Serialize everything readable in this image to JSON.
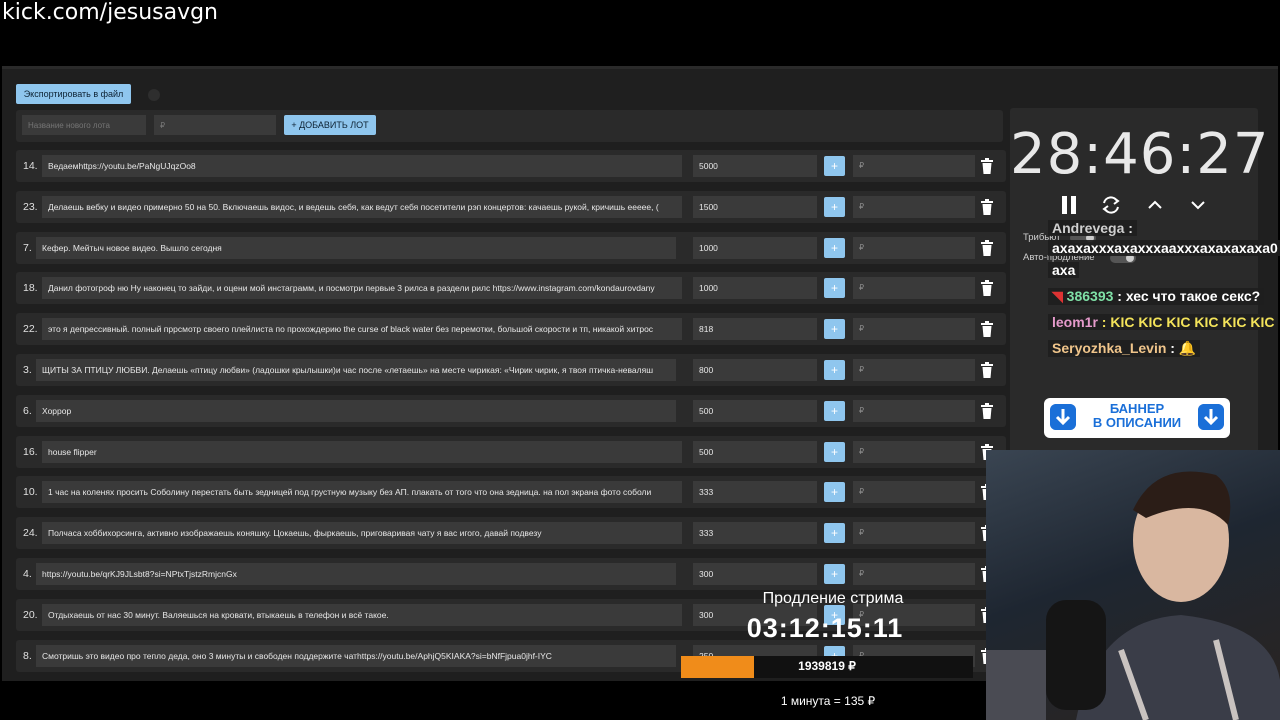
{
  "url": "kick.com/jesusavgn",
  "toolbar": {
    "export_label": "Экспортировать в файл"
  },
  "add_lot": {
    "name_placeholder": "Название нового лота",
    "price_placeholder": "₽",
    "add_label": "+ ДОБАВИТЬ ЛОТ"
  },
  "lots": [
    {
      "num": "14.",
      "name": "Ведаемhttps://youtu.be/PaNgUJqzOo8",
      "amount": "5000",
      "add_placeholder": "₽"
    },
    {
      "num": "23.",
      "name": "Делаешь вебку и видео примерно 50 на 50. Включаешь видос, и ведешь себя, как ведут себя посетители рэп концертов: качаешь рукой, кричишь еееее, (",
      "amount": "1500",
      "add_placeholder": "₽"
    },
    {
      "num": "7.",
      "name": "Кефер. Мейтыч новое видео. Вышло сегодня",
      "amount": "1000",
      "add_placeholder": "₽"
    },
    {
      "num": "18.",
      "name": "Данил фотогроф ню Ну наконец то зайди, и оцени мой инстаграмм, и посмотри первые 3 рилса в раздели рилс https://www.instagram.com/kondaurovdany",
      "amount": "1000",
      "add_placeholder": "₽"
    },
    {
      "num": "22.",
      "name": "это я депрессивный. полный пррсмотр своего плейлиста по прохождерию the curse of black water без перемотки, большой скорости и тп, никакой хитрос",
      "amount": "818",
      "add_placeholder": "₽"
    },
    {
      "num": "3.",
      "name": "ЩИТЫ ЗА ПТИЦУ ЛЮБВИ. Делаешь «птицу любви» (ладошки крылышки)и час после «летаешь» на месте чирикая: «Чирик чирик, я твоя птичка-неваляш",
      "amount": "800",
      "add_placeholder": "₽"
    },
    {
      "num": "6.",
      "name": "Хоррор",
      "amount": "500",
      "add_placeholder": "₽"
    },
    {
      "num": "16.",
      "name": "house flipper",
      "amount": "500",
      "add_placeholder": "₽"
    },
    {
      "num": "10.",
      "name": "1 час на коленях просить Соболину перестать быть зедницей под грустную музыку без АП. плакать от того что она зедница. на пол экрана фото соболи",
      "amount": "333",
      "add_placeholder": "₽"
    },
    {
      "num": "24.",
      "name": "Полчаса хоббихорсинга, активно изображаешь коняшку. Цокаешь, фыркаешь, приговаривая чату я вас игого, давай подвезу",
      "amount": "333",
      "add_placeholder": "₽"
    },
    {
      "num": "4.",
      "name": "https://youtu.be/qrKJ9JLsbt8?si=NPtxTjstzRmjcnGx",
      "amount": "300",
      "add_placeholder": "₽"
    },
    {
      "num": "20.",
      "name": "Отдыхаешь от нас 30 минут. Валяешься на кровати, втыкаешь в телефон и всё такое.",
      "amount": "300",
      "add_placeholder": "₽"
    },
    {
      "num": "8.",
      "name": "Смотришь это видео про тепло деда, оно 3 минуты и свободен поддержите чатhttps://youtu.be/AphjQ5KIAKA?si=bNfFjpua0jhf-IYC",
      "amount": "250",
      "add_placeholder": "₽"
    }
  ],
  "timer": {
    "value": "28:46:27",
    "tribute_label": "Трибьют",
    "auto_extend_label": "Авто-продление"
  },
  "chat": [
    {
      "user": "Andrevega",
      "text": " :"
    },
    {
      "user": "",
      "text": "ахахахххахахххаахххахахахаха0"
    },
    {
      "user": "",
      "text": "аха"
    },
    {
      "user": "386393",
      "text": " : хес что такое секс?",
      "user_color": "#7fe0a6"
    },
    {
      "user": "leom1r",
      "text": " : KIC KIC KIC KIC KIC KIC",
      "user_color": "#e59acb"
    },
    {
      "user": "Seryozhka_Levin",
      "text": " : 🔔",
      "user_color": "#f0c58b"
    }
  ],
  "banner": {
    "line1": "БАННЕР",
    "line2": "В ОПИСАНИИ"
  },
  "extension": {
    "label": "Продление стрима",
    "time": "03:12:15:11",
    "amount": "1939819 ₽",
    "progress": 0.25,
    "rate": "1 минута = 135 ₽"
  },
  "colors": {
    "accent": "#8fc6ee",
    "progress": "#f08c1a",
    "panel": "#2a2a2a"
  }
}
